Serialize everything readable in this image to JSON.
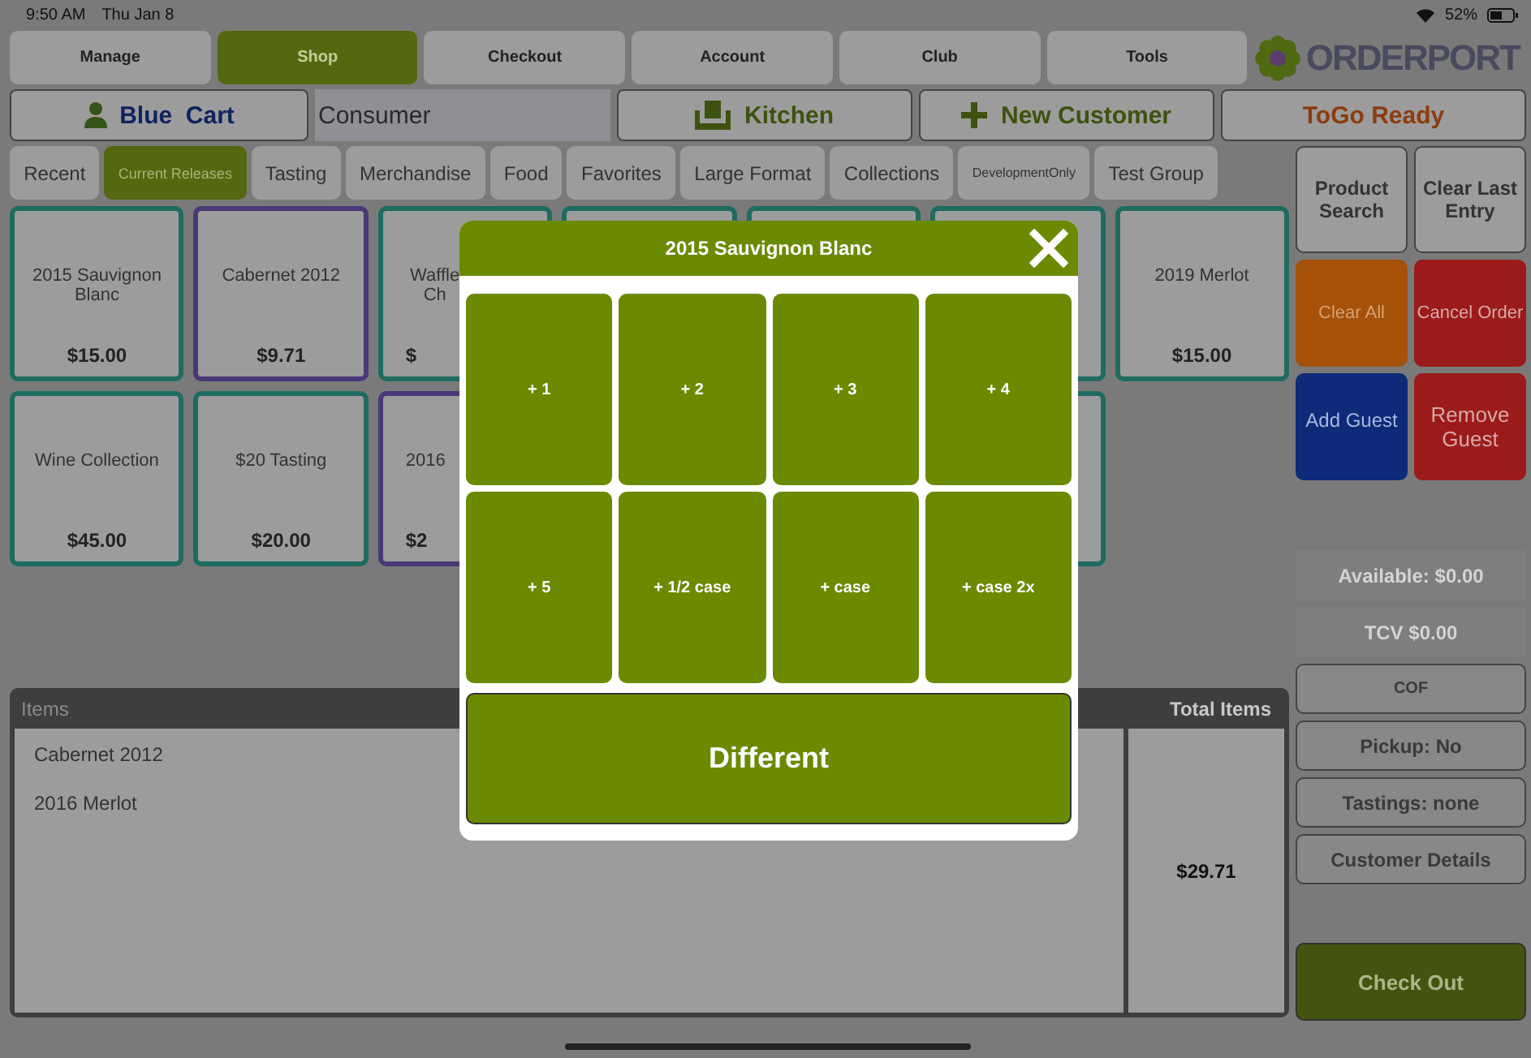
{
  "status_bar": {
    "time": "9:50 AM",
    "date": "Thu Jan 8",
    "battery": "52%"
  },
  "nav_tabs": [
    {
      "label": "Manage",
      "selected": false
    },
    {
      "label": "Shop",
      "selected": true
    },
    {
      "label": "Checkout",
      "selected": false
    },
    {
      "label": "Account",
      "selected": false
    },
    {
      "label": "Club",
      "selected": false
    },
    {
      "label": "Tools",
      "selected": false
    }
  ],
  "logo": "ORDERPORT",
  "cart_bar": {
    "cart": "Blue  Cart",
    "customer_type": "Consumer",
    "kitchen": "Kitchen",
    "new_customer": "New Customer",
    "togo": "ToGo Ready"
  },
  "categories": [
    {
      "label": "Recent",
      "selected": false
    },
    {
      "label": "Current Releases",
      "selected": true
    },
    {
      "label": "Tasting",
      "selected": false
    },
    {
      "label": "Merchandise",
      "selected": false
    },
    {
      "label": "Food",
      "selected": false
    },
    {
      "label": "Favorites",
      "selected": false
    },
    {
      "label": "Large Format",
      "selected": false
    },
    {
      "label": "Collections",
      "selected": false
    },
    {
      "label": "DevelopmentOnly",
      "selected": false
    },
    {
      "label": "Test Group",
      "selected": false
    }
  ],
  "products": [
    {
      "kind": "full",
      "name": "2015 Sauvignon Blanc",
      "price": "$15.00",
      "color": "#1f6b60"
    },
    {
      "kind": "full",
      "name": "Cabernet 2012",
      "price": "$9.71",
      "color": "#4a3878"
    },
    {
      "kind": "partial",
      "name": "Waffle Ch",
      "price": "$",
      "color": "#1f6b60"
    },
    {
      "kind": "hidden",
      "color": "#1f6b60"
    },
    {
      "kind": "hidden",
      "color": "#1f6b60"
    },
    {
      "kind": "hidden",
      "color": "#1f6b60"
    },
    {
      "kind": "full",
      "name": "2019 Merlot",
      "price": "$15.00",
      "color": "#1f6b60"
    },
    {
      "kind": "full",
      "name": "Wine Collection",
      "price": "$45.00",
      "color": "#1f6b60"
    },
    {
      "kind": "full",
      "name": "$20 Tasting",
      "price": "$20.00",
      "color": "#1f6b60"
    },
    {
      "kind": "partial",
      "name": "2016",
      "price": "$2",
      "color": "#4a3878"
    },
    {
      "kind": "hidden",
      "color": "#1f6b60"
    }
  ],
  "actions": [
    {
      "label": "Product Search",
      "color": "#9c9c9c"
    },
    {
      "label": "Clear Last Entry",
      "color": "#9c9c9c"
    },
    {
      "label": "Clear All",
      "color": "#a5510a"
    },
    {
      "label": "Cancel Order",
      "color": "#9b1b1b"
    },
    {
      "label": "Add Guest",
      "color": "#0e2a78"
    },
    {
      "label": "Remove Guest",
      "color": "#9b1b1b"
    }
  ],
  "info": [
    {
      "kind": "label",
      "text": "Available: $0.00"
    },
    {
      "kind": "label",
      "text": "TCV $0.00"
    },
    {
      "kind": "button",
      "text": "COF"
    },
    {
      "kind": "button",
      "text": "Pickup: No"
    },
    {
      "kind": "button",
      "text": "Tastings: none"
    },
    {
      "kind": "button",
      "text": "Customer Details"
    }
  ],
  "checkout": "Check Out",
  "items": {
    "header": "Items",
    "total_header": "Total Items",
    "rows": [
      "Cabernet 2012",
      "2016 Merlot"
    ],
    "total": "$29.71"
  },
  "modal": {
    "title": "2015 Sauvignon Blanc",
    "options": [
      "+ 1",
      "+ 2",
      "+ 3",
      "+ 4",
      "+ 5",
      "+ 1/2 case",
      "+ case",
      "+ case 2x"
    ],
    "different": "Different"
  }
}
